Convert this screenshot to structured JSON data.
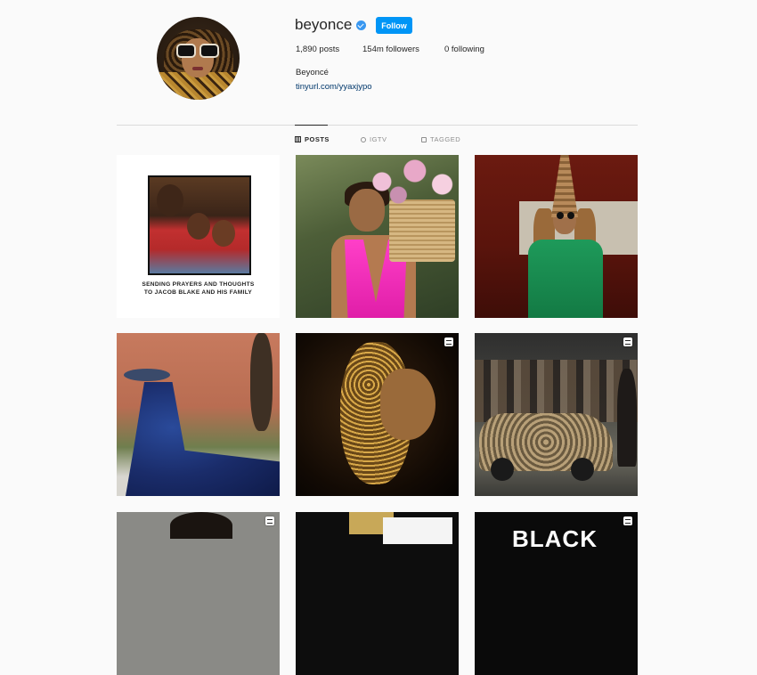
{
  "profile": {
    "username": "beyonce",
    "follow_label": "Follow",
    "full_name": "Beyoncé",
    "link": "tinyurl.com/yyaxjypo",
    "stats": {
      "posts": "1,890 posts",
      "followers": "154m followers",
      "following": "0 following"
    }
  },
  "tabs": [
    {
      "label": "POSTS",
      "icon": "grid-icon",
      "active": true
    },
    {
      "label": "IGTV",
      "icon": "igtv-icon",
      "active": false
    },
    {
      "label": "TAGGED",
      "icon": "tagged-icon",
      "active": false
    }
  ],
  "posts": [
    {
      "caption_lines": [
        "SENDING PRAYERS AND THOUGHTS",
        "TO JACOB BLAKE AND HIS FAMILY"
      ],
      "video": false
    },
    {
      "video": false
    },
    {
      "video": false
    },
    {
      "video": false
    },
    {
      "video": true
    },
    {
      "video": true
    },
    {
      "video": true
    },
    {
      "video": false
    },
    {
      "overlay_text": "BLACK",
      "video": true
    }
  ],
  "colors": {
    "follow_button": "#0095f6",
    "verified_badge": "#3897f0",
    "link": "#00376b",
    "background": "#fafafa"
  }
}
